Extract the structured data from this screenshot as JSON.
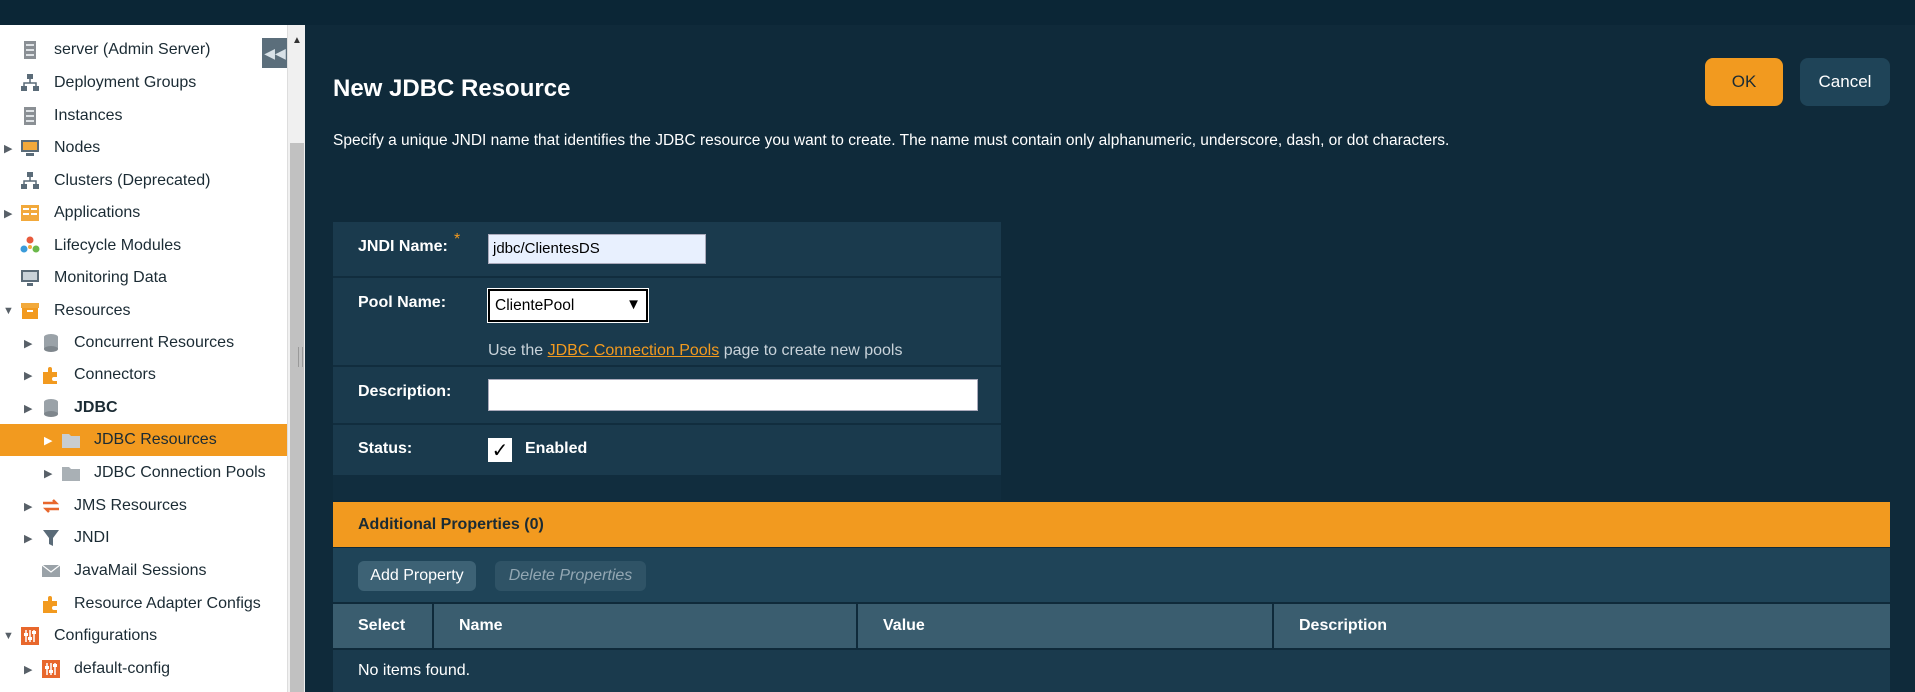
{
  "sidebar": {
    "items": [
      {
        "label": "server (Admin Server)",
        "icon": "server-icon"
      },
      {
        "label": "Deployment Groups",
        "icon": "cluster-icon"
      },
      {
        "label": "Instances",
        "icon": "server-icon"
      },
      {
        "label": "Nodes",
        "icon": "node-monitor-icon"
      },
      {
        "label": "Clusters (Deprecated)",
        "icon": "cluster-icon"
      },
      {
        "label": "Applications",
        "icon": "applications-icon"
      },
      {
        "label": "Lifecycle Modules",
        "icon": "lifecycle-icon"
      },
      {
        "label": "Monitoring Data",
        "icon": "monitor-icon"
      },
      {
        "label": "Resources",
        "icon": "resources-box-icon"
      },
      {
        "label": "Concurrent Resources",
        "icon": "database-icon"
      },
      {
        "label": "Connectors",
        "icon": "puzzle-icon"
      },
      {
        "label": "JDBC",
        "icon": "database-icon"
      },
      {
        "label": "JDBC Resources",
        "icon": "folder-icon"
      },
      {
        "label": "JDBC Connection Pools",
        "icon": "folder-icon"
      },
      {
        "label": "JMS Resources",
        "icon": "exchange-arrows-icon"
      },
      {
        "label": "JNDI",
        "icon": "funnel-icon"
      },
      {
        "label": "JavaMail Sessions",
        "icon": "envelope-icon"
      },
      {
        "label": "Resource Adapter Configs",
        "icon": "puzzle-icon"
      },
      {
        "label": "Configurations",
        "icon": "config-sliders-icon"
      },
      {
        "label": "default-config",
        "icon": "config-sliders-icon"
      }
    ],
    "selected": "JDBC Resources"
  },
  "page": {
    "title": "New JDBC Resource",
    "help": "Specify a unique JNDI name that identifies the JDBC resource you want to create. The name must contain only alphanumeric, underscore, dash, or dot characters.",
    "ok_label": "OK",
    "cancel_label": "Cancel"
  },
  "form": {
    "jndi_label": "JNDI Name:",
    "required_mark": "*",
    "jndi_value": "jdbc/ClientesDS",
    "pool_label": "Pool Name:",
    "pool_value": "ClientePool",
    "pool_hint_pre": "Use the",
    "pool_hint_link": "JDBC Connection Pools",
    "pool_hint_post": "page to create new pools",
    "description_label": "Description:",
    "description_value": "",
    "status_label": "Status:",
    "status_checked": true,
    "status_check_label": "Enabled"
  },
  "properties": {
    "header": "Additional Properties (0)",
    "add_label": "Add Property",
    "delete_label": "Delete Properties",
    "columns": [
      "Select",
      "Name",
      "Value",
      "Description"
    ],
    "empty_text": "No items found."
  },
  "colors": {
    "accent": "#f29a1f",
    "background": "#0f2a3a",
    "panel": "#1a3a4d"
  }
}
